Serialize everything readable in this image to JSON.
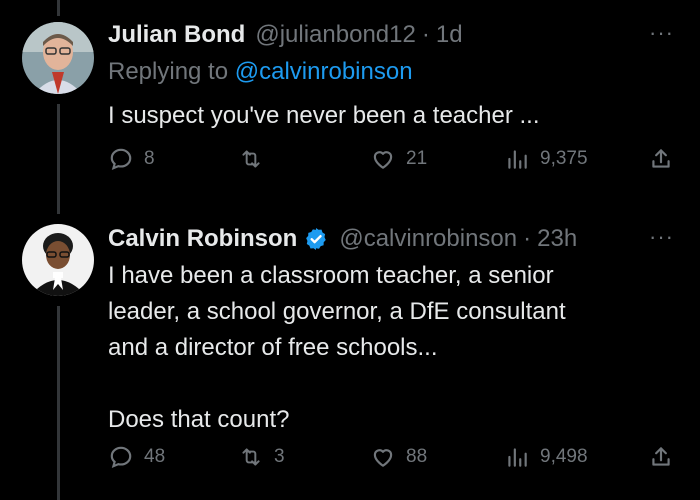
{
  "tweets": [
    {
      "display_name": "Julian Bond",
      "handle": "@julianbond12",
      "separator": "·",
      "time": "1d",
      "more": "···",
      "reply_prefix": "Replying to",
      "reply_mention": "@calvinrobinson",
      "text": "I suspect you've never been a teacher ...",
      "replies": "8",
      "retweets": "",
      "likes": "21",
      "views": "9,375"
    },
    {
      "display_name": "Calvin Robinson",
      "handle": "@calvinrobinson",
      "separator": "·",
      "time": "23h",
      "more": "···",
      "verified": true,
      "text_lines": [
        "I have been a classroom teacher, a senior",
        "leader, a school governor, a DfE consultant",
        "and a director of free schools...",
        "",
        "Does that count?"
      ],
      "replies": "48",
      "retweets": "3",
      "likes": "88",
      "views": "9,498"
    }
  ],
  "icons": {
    "reply": "reply-icon",
    "retweet": "retweet-icon",
    "like": "heart-icon",
    "views": "views-icon",
    "share": "share-icon",
    "verified": "verified-badge-icon"
  },
  "colors": {
    "background": "#000000",
    "primary_text": "#e7e9ea",
    "secondary_text": "#71767b",
    "link": "#1d9bf0",
    "verified": "#1d9bf0"
  }
}
